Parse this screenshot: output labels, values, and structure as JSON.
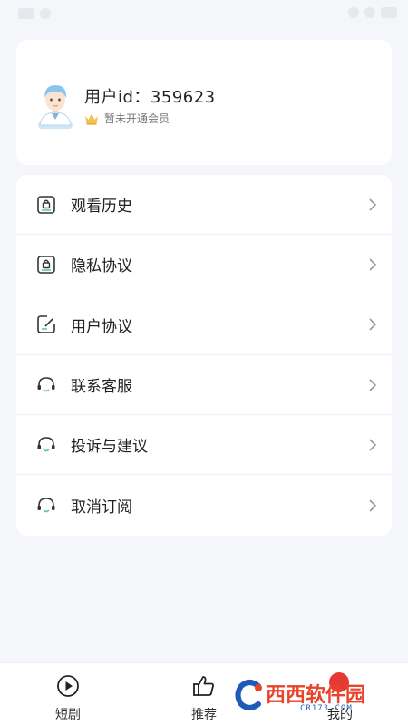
{
  "profile": {
    "user_id": "用户id：359623",
    "vip_status": "暂未开通会员"
  },
  "menu": {
    "items": [
      {
        "label": "观看历史",
        "icon": "lock-doc-icon"
      },
      {
        "label": "隐私协议",
        "icon": "lock-doc-icon"
      },
      {
        "label": "用户协议",
        "icon": "edit-doc-icon"
      },
      {
        "label": "联系客服",
        "icon": "headset-icon"
      },
      {
        "label": "投诉与建议",
        "icon": "headset-icon"
      },
      {
        "label": "取消订阅",
        "icon": "headset-icon"
      }
    ]
  },
  "tabs": [
    {
      "label": "短剧",
      "icon": "play-circle-icon"
    },
    {
      "label": "推荐",
      "icon": "thumbs-up-icon"
    },
    {
      "label": "我的",
      "icon": "profile-icon"
    }
  ],
  "watermark": {
    "brand": "西西软件园",
    "url": "CR173.COM"
  },
  "colors": {
    "background": "#f5f6fa",
    "card": "#ffffff",
    "accent_gold": "#f2c14e",
    "icon_teal": "#5fc7b4",
    "badge_red": "#e53935"
  }
}
